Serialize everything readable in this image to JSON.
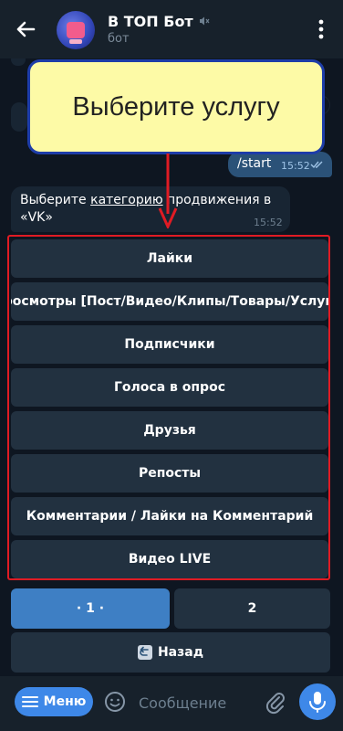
{
  "header": {
    "title": "В ТОП Бот",
    "subtitle": "бот"
  },
  "callout": {
    "text": "Выберите услугу"
  },
  "outgoing_message": {
    "text": "/start",
    "time": "15:52"
  },
  "incoming_message": {
    "text_before": "Выберите ",
    "link": "категорию",
    "text_after": " продвижения в «VK»",
    "time": "15:52"
  },
  "keyboard": {
    "buttons": [
      "Лайки",
      "Просмотры [Пост/Видео/Клипы/Товары/Услуги]",
      "Подписчики",
      "Голоса в опрос",
      "Друзья",
      "Репосты",
      "Комментарии / Лайки на Комментарий",
      "Видео LIVE"
    ],
    "page_current": "· 1 ·",
    "page_next": "2",
    "back_label": "Назад"
  },
  "bottom": {
    "menu_label": "Меню",
    "placeholder": "Сообщение"
  },
  "colors": {
    "background": "#0e1621",
    "header": "#17212b",
    "accent": "#3e88e8",
    "outgoing": "#2b5278",
    "incoming": "#182533",
    "button": "#223140",
    "highlight_frame": "#e01b24",
    "callout_fill": "#fdfaa6",
    "callout_border": "#1e3da8"
  }
}
